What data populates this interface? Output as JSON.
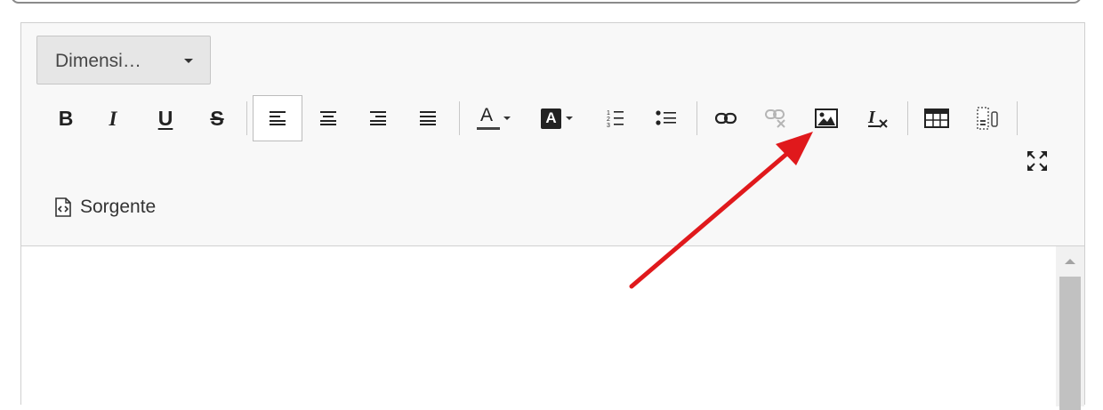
{
  "toolbar": {
    "size_combo": {
      "label": "Dimensi…"
    },
    "buttons": [
      {
        "name": "bold-button",
        "glyph": "B"
      },
      {
        "name": "italic-button",
        "glyph": "I"
      },
      {
        "name": "underline-button",
        "glyph": "U"
      },
      {
        "name": "strikethrough-button",
        "glyph": "S"
      },
      {
        "name": "align-left-button",
        "active": true
      },
      {
        "name": "align-center-button"
      },
      {
        "name": "align-right-button"
      },
      {
        "name": "justify-button"
      },
      {
        "name": "text-color-button",
        "glyph": "A"
      },
      {
        "name": "background-color-button",
        "glyph": "A"
      },
      {
        "name": "numbered-list-button"
      },
      {
        "name": "bulleted-list-button"
      },
      {
        "name": "link-button"
      },
      {
        "name": "unlink-button",
        "disabled": true
      },
      {
        "name": "image-button"
      },
      {
        "name": "remove-format-button",
        "glyph": "Ix"
      },
      {
        "name": "table-button"
      },
      {
        "name": "special-block-button"
      },
      {
        "name": "maximize-button"
      }
    ],
    "source": {
      "label": "Sorgente"
    }
  },
  "colors": {
    "toolbar_bg": "#f8f8f8",
    "annotation_arrow": "#e0191c",
    "disabled_icon": "#b5b5b5"
  }
}
